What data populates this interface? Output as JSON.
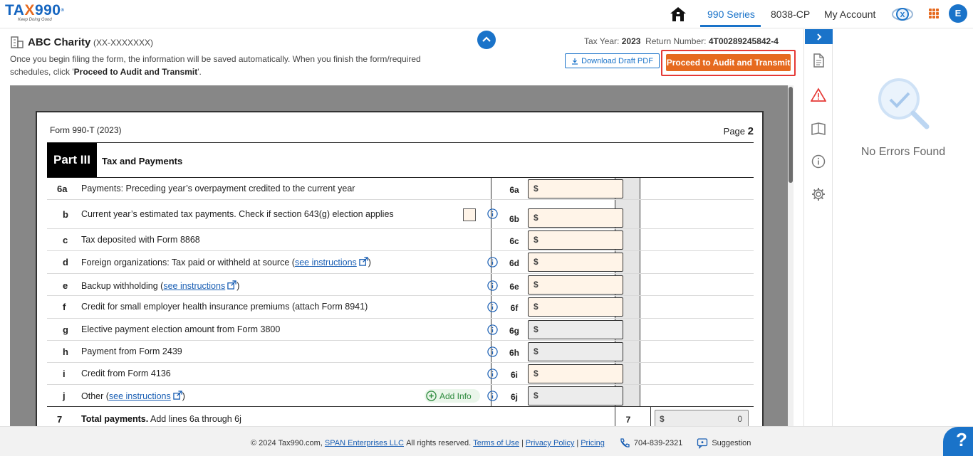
{
  "brand": {
    "logo_main": "TA",
    "logo_x": "X",
    "logo_rest": "990",
    "logo_reg": "®",
    "tagline": "Keep Doing Good"
  },
  "nav": {
    "series_990": "990 Series",
    "cp_8038": "8038-CP",
    "my_account": "My Account",
    "avatar_letter": "E"
  },
  "header": {
    "org_name": "ABC Charity",
    "org_ein": "(XX-XXXXXXX)",
    "info_line1": "Once you begin filing the form, the information will be saved automatically. When you finish the form/required",
    "info_line2_prefix": "schedules, click '",
    "info_line2_bold": "Proceed to Audit and Transmit",
    "info_line2_suffix": "'.",
    "tax_year_label": "Tax Year:",
    "tax_year": "2023",
    "return_label": "Return Number:",
    "return_number": "4T00289245842-4",
    "download_label": "Download Draft PDF",
    "proceed_label": "Proceed to Audit and Transmit"
  },
  "form": {
    "form_name": "Form 990-T (2023)",
    "page_label": "Page",
    "page_num": "2",
    "part_label": "Part III",
    "part_title": "Tax and Payments",
    "currency": "$",
    "lines": [
      {
        "num": "6a",
        "text": "Payments: Preceding year’s overpayment credited to the current year",
        "code": "6a",
        "gray": false
      },
      {
        "num": "b",
        "text": "Current year’s estimated tax payments. Check if section 643(g) election applies",
        "code": "6b",
        "gray": false
      },
      {
        "num": "c",
        "text": "Tax deposited with Form 8868",
        "code": "6c",
        "gray": false
      },
      {
        "num": "d",
        "text_prefix": "Foreign organizations: Tax paid or withheld at source (",
        "link": "see instructions",
        "text_suffix": ")",
        "code": "6d",
        "gray": false
      },
      {
        "num": "e",
        "text_prefix": "Backup withholding (",
        "link": "see instructions",
        "text_suffix": ")",
        "code": "6e",
        "gray": false
      },
      {
        "num": "f",
        "text": "Credit for small employer health insurance premiums (attach Form 8941)",
        "code": "6f",
        "gray": false
      },
      {
        "num": "g",
        "text": "Elective payment election amount from Form 3800",
        "code": "6g",
        "gray": true
      },
      {
        "num": "h",
        "text": "Payment from Form 2439",
        "code": "6h",
        "gray": true
      },
      {
        "num": "i",
        "text": "Credit from Form 4136",
        "code": "6i",
        "gray": false
      },
      {
        "num": "j",
        "text_prefix": "Other (",
        "link": "see instructions",
        "text_suffix": ")",
        "code": "6j",
        "gray": true
      }
    ],
    "add_info_label": "Add Info",
    "total": {
      "num": "7",
      "bold": "Total payments.",
      "text": " Add lines 6a through 6j",
      "code": "7",
      "value": "0"
    }
  },
  "right_panel": {
    "no_errors": "No Errors Found"
  },
  "footer": {
    "copyright": "© 2024 Tax990.com,",
    "span": "SPAN Enterprises LLC",
    "rights": "All rights reserved.",
    "terms": "Terms of Use",
    "privacy": "Privacy Policy",
    "pricing": "Pricing",
    "phone": "704-839-2321",
    "suggestion": "Suggestion",
    "sep": "|"
  },
  "help_label": "?",
  "colors": {
    "primary": "#1a73c9",
    "accent": "#e66a1f",
    "input_bg": "#fff4e8",
    "highlight_border": "#e53935"
  }
}
